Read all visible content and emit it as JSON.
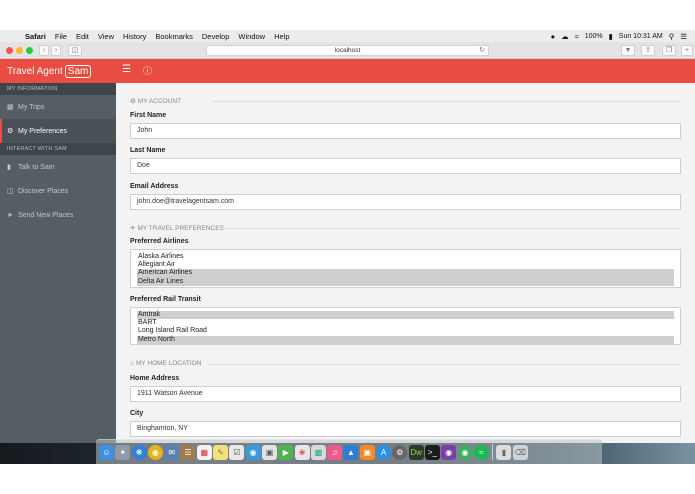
{
  "menubar": {
    "apple_glyph": "",
    "app_name": "Safari",
    "items": [
      "File",
      "Edit",
      "View",
      "History",
      "Bookmarks",
      "Develop",
      "Window",
      "Help"
    ],
    "battery": "100%",
    "clock": "Sun 10:31 AM"
  },
  "browser": {
    "url": "localhost"
  },
  "header": {
    "brand_prefix": "Travel Agent",
    "brand_boxed": "Sam"
  },
  "sidebar": {
    "section_info": "MY INFORMATION",
    "trips": "My Trips",
    "preferences": "My Preferences",
    "section_interact": "INTERACT WITH SAM",
    "talk": "Talk to Sam",
    "discover": "Discover Places",
    "send": "Send New Places"
  },
  "account": {
    "heading": "MY ACCOUNT",
    "first_name_label": "First Name",
    "first_name": "John",
    "last_name_label": "Last Name",
    "last_name": "Doe",
    "email_label": "Email Address",
    "email": "john.doe@travelagentsam.com"
  },
  "travel": {
    "heading": "MY TRAVEL PREFERENCES",
    "airlines_label": "Preferred Airlines",
    "airlines": [
      {
        "name": "Alaska Airlines",
        "selected": false
      },
      {
        "name": "Allegiant Air",
        "selected": false
      },
      {
        "name": "American Airlines",
        "selected": true
      },
      {
        "name": "Delta Air Lines",
        "selected": true
      }
    ],
    "rail_label": "Preferred Rail Transit",
    "rail": [
      {
        "name": "Amtrak",
        "selected": true
      },
      {
        "name": "BART",
        "selected": false
      },
      {
        "name": "Long Island Rail Road",
        "selected": false
      },
      {
        "name": "Metro North",
        "selected": true
      }
    ]
  },
  "home": {
    "heading": "MY HOME LOCATION",
    "address_label": "Home Address",
    "address": "1911 Watson Avenue",
    "city_label": "City",
    "city": "Binghamton, NY"
  },
  "colors": {
    "accent": "#e94d41",
    "sidebar": "#555e65",
    "selected_option": "#cfcfcf"
  }
}
